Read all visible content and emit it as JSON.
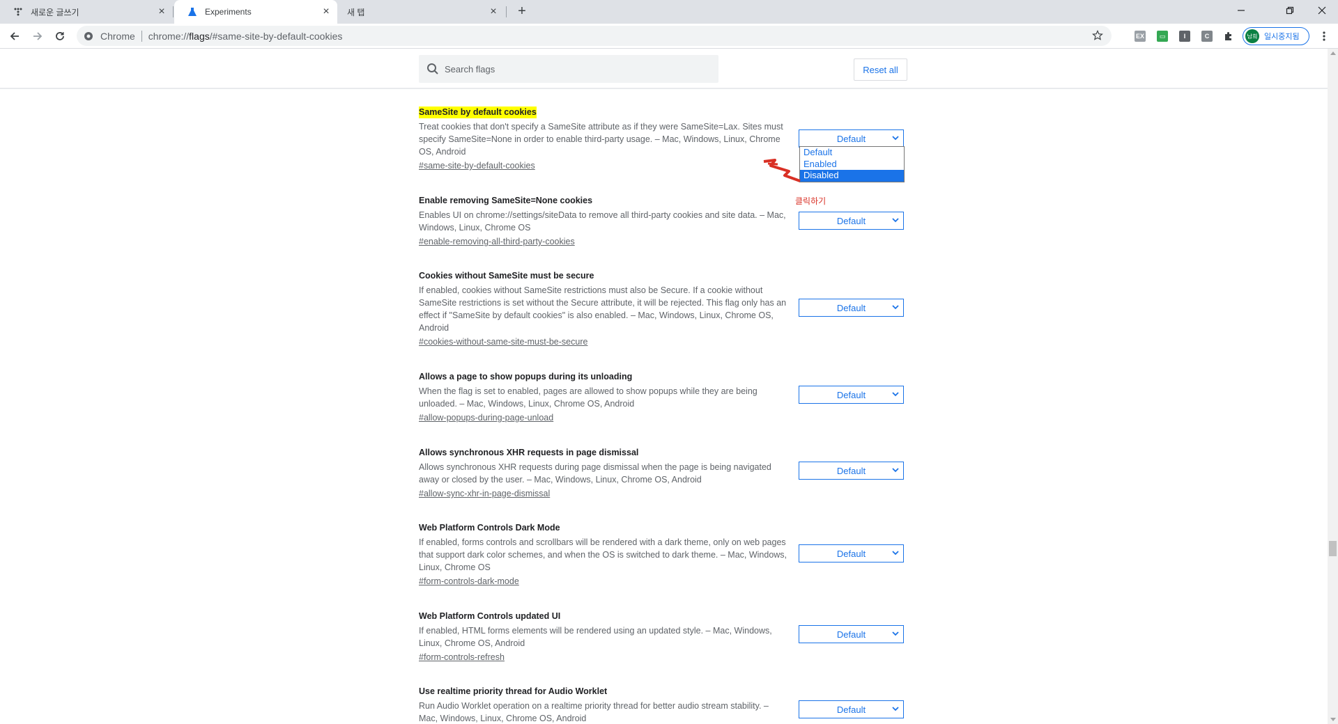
{
  "tabs": [
    {
      "title": "새로운 글쓰기",
      "icon": "dots-icon"
    },
    {
      "title": "Experiments",
      "icon": "flask-icon",
      "active": true
    },
    {
      "title": "새 탭",
      "icon": "none"
    }
  ],
  "toolbar": {
    "site_chip": "Chrome",
    "url_host": "chrome://",
    "url_path": "flags",
    "url_rest": "/#same-site-by-default-cookies",
    "extensions": [
      "EX",
      "▭",
      "I",
      "C"
    ],
    "profile_avatar": "남희",
    "profile_label": "일시중지됨"
  },
  "header": {
    "search_placeholder": "Search flags",
    "reset_label": "Reset all"
  },
  "flags": [
    {
      "title": "SameSite by default cookies",
      "highlighted": true,
      "description": "Treat cookies that don't specify a SameSite attribute as if they were SameSite=Lax. Sites must specify SameSite=None in order to enable third-party usage. – Mac, Windows, Linux, Chrome OS, Android",
      "anchor": "#same-site-by-default-cookies",
      "value": "Default"
    },
    {
      "title": "Enable removing SameSite=None cookies",
      "description": "Enables UI on chrome://settings/siteData to remove all third-party cookies and site data. – Mac, Windows, Linux, Chrome OS",
      "anchor": "#enable-removing-all-third-party-cookies",
      "value": "Default"
    },
    {
      "title": "Cookies without SameSite must be secure",
      "description": "If enabled, cookies without SameSite restrictions must also be Secure. If a cookie without SameSite restrictions is set without the Secure attribute, it will be rejected. This flag only has an effect if \"SameSite by default cookies\" is also enabled. – Mac, Windows, Linux, Chrome OS, Android",
      "anchor": "#cookies-without-same-site-must-be-secure",
      "value": "Default"
    },
    {
      "title": "Allows a page to show popups during its unloading",
      "description": "When the flag is set to enabled, pages are allowed to show popups while they are being unloaded. – Mac, Windows, Linux, Chrome OS, Android",
      "anchor": "#allow-popups-during-page-unload",
      "value": "Default"
    },
    {
      "title": "Allows synchronous XHR requests in page dismissal",
      "description": "Allows synchronous XHR requests during page dismissal when the page is being navigated away or closed by the user. – Mac, Windows, Linux, Chrome OS, Android",
      "anchor": "#allow-sync-xhr-in-page-dismissal",
      "value": "Default"
    },
    {
      "title": "Web Platform Controls Dark Mode",
      "description": "If enabled, forms controls and scrollbars will be rendered with a dark theme, only on web pages that support dark color schemes, and when the OS is switched to dark theme. – Mac, Windows, Linux, Chrome OS",
      "anchor": "#form-controls-dark-mode",
      "value": "Default"
    },
    {
      "title": "Web Platform Controls updated UI",
      "description": "If enabled, HTML forms elements will be rendered using an updated style. – Mac, Windows, Linux, Chrome OS, Android",
      "anchor": "#form-controls-refresh",
      "value": "Default"
    },
    {
      "title": "Use realtime priority thread for Audio Worklet",
      "description": "Run Audio Worklet operation on a realtime priority thread for better audio stream stability. – Mac, Windows, Linux, Chrome OS, Android",
      "anchor": "",
      "value": "Default"
    }
  ],
  "dropdown": {
    "options": [
      "Default",
      "Enabled",
      "Disabled"
    ],
    "highlighted": "Disabled"
  },
  "annotation": {
    "text": "클릭하기",
    "color": "#d93025"
  },
  "colors": {
    "accent": "#1a73e8",
    "highlight": "#ffff00"
  }
}
